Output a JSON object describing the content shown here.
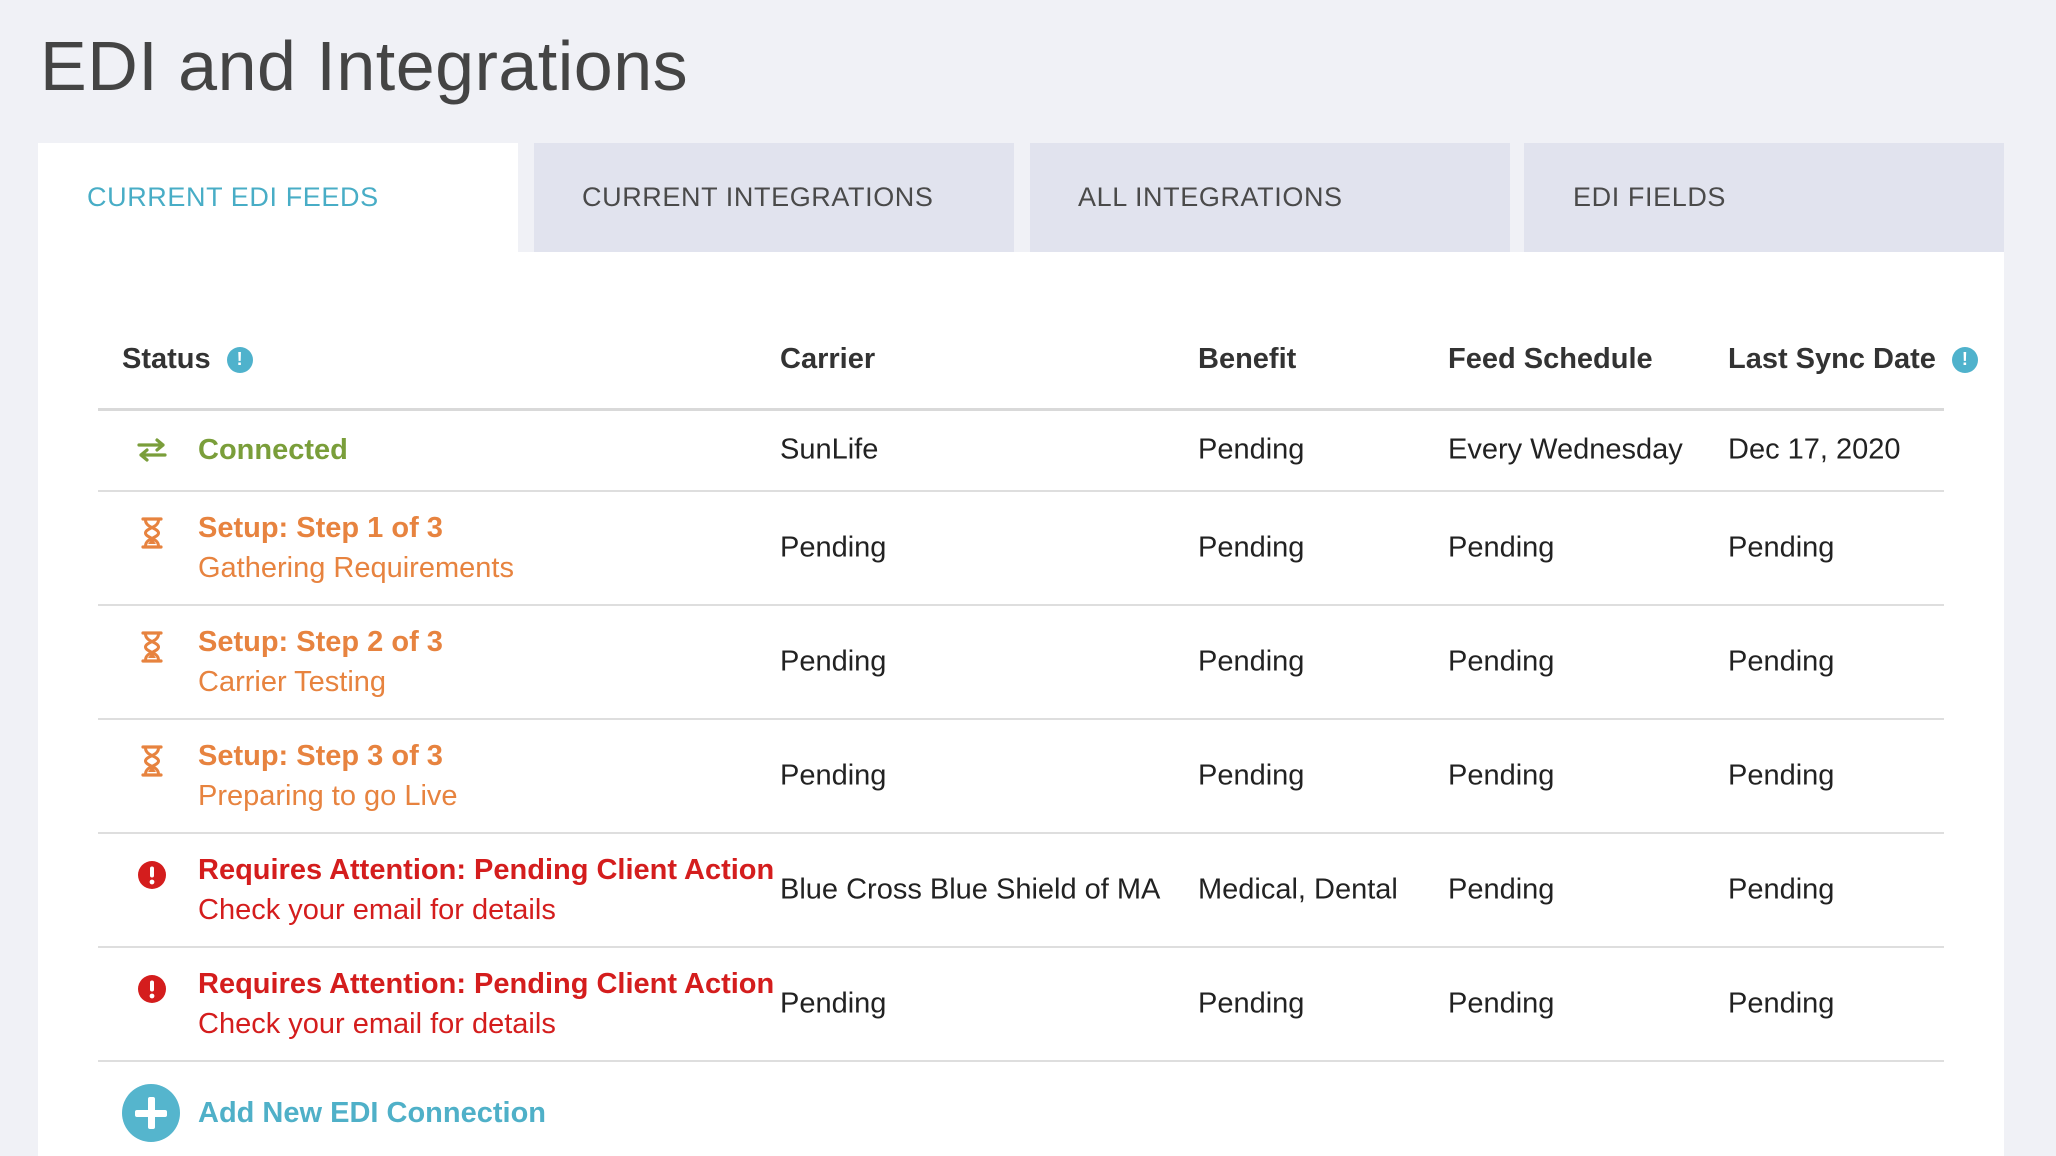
{
  "page": {
    "title": "EDI and Integrations"
  },
  "tabs": [
    {
      "label": "CURRENT EDI FEEDS",
      "active": true
    },
    {
      "label": "CURRENT INTEGRATIONS",
      "active": false
    },
    {
      "label": "ALL INTEGRATIONS",
      "active": false
    },
    {
      "label": "EDI FIELDS",
      "active": false
    }
  ],
  "table": {
    "columns": {
      "status": "Status",
      "carrier": "Carrier",
      "benefit": "Benefit",
      "feed_schedule": "Feed Schedule",
      "last_sync": "Last Sync Date"
    },
    "info_icon_glyph": "!",
    "rows": [
      {
        "status_main": "Connected",
        "status_sub": "",
        "status_type": "connected",
        "icon": "sync-arrows-icon",
        "carrier": "SunLife",
        "benefit": "Pending",
        "feed_schedule": "Every Wednesday",
        "last_sync": "Dec 17, 2020"
      },
      {
        "status_main": "Setup: Step 1 of 3",
        "status_sub": "Gathering Requirements",
        "status_type": "setup",
        "icon": "hourglass-icon",
        "carrier": "Pending",
        "benefit": "Pending",
        "feed_schedule": "Pending",
        "last_sync": "Pending"
      },
      {
        "status_main": "Setup: Step 2 of 3",
        "status_sub": "Carrier Testing",
        "status_type": "setup",
        "icon": "hourglass-icon",
        "carrier": "Pending",
        "benefit": "Pending",
        "feed_schedule": "Pending",
        "last_sync": "Pending"
      },
      {
        "status_main": "Setup: Step 3 of 3",
        "status_sub": "Preparing to go Live",
        "status_type": "setup",
        "icon": "hourglass-icon",
        "carrier": "Pending",
        "benefit": "Pending",
        "feed_schedule": "Pending",
        "last_sync": "Pending"
      },
      {
        "status_main": "Requires Attention: Pending Client Action",
        "status_sub": "Check your email for details",
        "status_type": "attention",
        "icon": "alert-icon",
        "carrier": "Blue Cross Blue Shield of MA",
        "benefit": "Medical, Dental",
        "feed_schedule": "Pending",
        "last_sync": "Pending"
      },
      {
        "status_main": "Requires Attention: Pending Client Action",
        "status_sub": "Check your email for details",
        "status_type": "attention",
        "icon": "alert-icon",
        "carrier": "Pending",
        "benefit": "Pending",
        "feed_schedule": "Pending",
        "last_sync": "Pending"
      }
    ]
  },
  "add_connection": {
    "label": "Add New EDI Connection",
    "icon": "plus-circle-icon"
  },
  "colors": {
    "accent": "#4fb0c8",
    "connected": "#7a9e3a",
    "setup": "#e7833f",
    "attention": "#d41d1d"
  }
}
